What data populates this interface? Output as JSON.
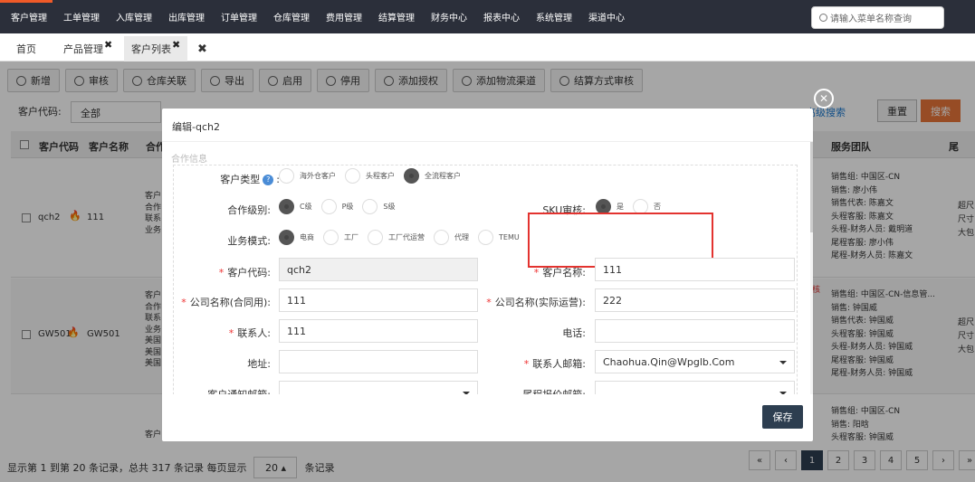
{
  "nav": {
    "items": [
      "客户管理",
      "工单管理",
      "入库管理",
      "出库管理",
      "订单管理",
      "仓库管理",
      "费用管理",
      "结算管理",
      "财务中心",
      "报表中心",
      "系统管理",
      "渠道中心"
    ],
    "search_placeholder": "请输入菜单名称查询"
  },
  "tabs": {
    "home": "首页",
    "product": "产品管理",
    "customer_list": "客户列表"
  },
  "toolbar": {
    "buttons": [
      "新增",
      "审核",
      "仓库关联",
      "导出",
      "启用",
      "停用",
      "添加授权",
      "添加物流渠道",
      "结算方式审核"
    ]
  },
  "filters": {
    "customer_code_label": "客户代码:",
    "customer_code_value": "全部",
    "advanced": "高级搜索",
    "reset": "重置",
    "search": "搜索"
  },
  "table": {
    "headers": [
      "客户代码",
      "客户名称",
      "合作",
      "服务团队",
      "尾"
    ],
    "rows": [
      {
        "code": "qch2",
        "name": "111",
        "info": [
          "客户",
          "合作",
          "联系",
          "业务"
        ],
        "team": [
          "销售组: 中国区-CN",
          "销售: 廖小伟",
          "销售代表: 陈嘉文",
          "头程客服: 陈嘉文",
          "头程-财务人员: 戴明道",
          "尾程客服: 廖小伟",
          "尾程-财务人员: 陈嘉文"
        ],
        "ext": [
          "超尺",
          "尺寸",
          "大包"
        ]
      },
      {
        "code": "GW501",
        "name": "GW501",
        "info": [
          "客户",
          "合作",
          "联系",
          "业务",
          "美国",
          "美国",
          "美国"
        ],
        "flag": "核",
        "team": [
          "销售组: 中国区-CN-信息管...",
          "销售: 钟国威",
          "销售代表: 钟国威",
          "头程客服: 钟国威",
          "头程-财务人员: 钟国威",
          "尾程客服: 钟国威",
          "尾程-财务人员: 钟国威"
        ],
        "ext": [
          "超尺",
          "尺寸",
          "大包"
        ]
      },
      {
        "info": [
          "客户"
        ],
        "team": [
          "销售组: 中国区-CN",
          "销售: 阳晗",
          "头程客服: 钟国威"
        ]
      }
    ]
  },
  "pager": {
    "info_prefix": "显示第 1 到第 20 条记录，总共 317 条记录 每页显示",
    "page_size": "20",
    "info_suffix": "条记录",
    "buttons": [
      "«",
      "‹",
      "1",
      "2",
      "3",
      "4",
      "5",
      "›",
      "»"
    ]
  },
  "modal": {
    "title": "编辑-qch2",
    "section": "合作信息",
    "customer_type": {
      "label": "客户类型",
      "options": [
        "海外仓客户",
        "头程客户",
        "全流程客户"
      ],
      "selected": 2
    },
    "coop_level": {
      "label": "合作级别:",
      "options": [
        "C级",
        "P级",
        "S级"
      ],
      "selected": 0
    },
    "sku_review": {
      "label": "SKU审核:",
      "options": [
        "是",
        "否"
      ],
      "selected": 0
    },
    "biz_mode": {
      "label": "业务模式:",
      "options": [
        "电商",
        "工厂",
        "工厂代运营",
        "代理",
        "TEMU"
      ],
      "selected": 0
    },
    "fields": {
      "customer_code_label": "客户代码:",
      "customer_code": "qch2",
      "customer_name_label": "客户名称:",
      "customer_name": "111",
      "company_contract_label": "公司名称(合同用):",
      "company_contract": "111",
      "company_actual_label": "公司名称(实际运营):",
      "company_actual": "222",
      "contact_label": "联系人:",
      "contact": "111",
      "phone_label": "电话:",
      "phone": "",
      "address_label": "地址:",
      "address": "",
      "contact_email_label": "联系人邮箱:",
      "contact_email": "Chaohua.Qin@Wpglb.Com",
      "notify_email_label": "客户通知邮箱:",
      "quote_email_label": "尾程报价邮箱:"
    },
    "save": "保存"
  }
}
